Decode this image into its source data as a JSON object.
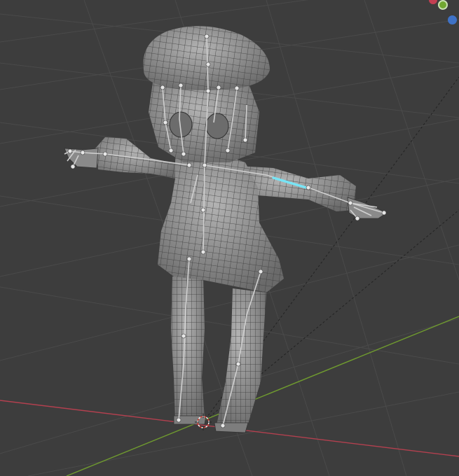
{
  "viewport": {
    "name": "3D Viewport",
    "background": "#3d3d3d",
    "grid_color": "#4a4a4a",
    "x_axis_color": "#b3404f",
    "y_axis_color": "#6f9a2f",
    "mesh_fill": "#8c8c8c",
    "wire_color": "#3a3a3a",
    "bone_color": "#c4c4c4",
    "selected_bone_color": "#77e4f5"
  },
  "navigation_gizmo": {
    "x_color": "#c33f52",
    "y_color": "#71a831",
    "z_color": "#3f72c6",
    "icons": [
      "axis-x-icon",
      "axis-y-icon",
      "axis-z-icon"
    ]
  },
  "scene": {
    "object": "character-mesh",
    "armature": "character-armature",
    "cursor": "3d-cursor-icon"
  }
}
